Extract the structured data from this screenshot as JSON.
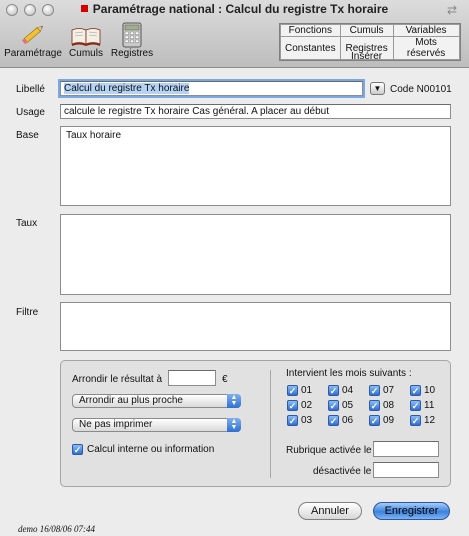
{
  "window": {
    "title": "Paramétrage national : Calcul du registre Tx horaire"
  },
  "toolbar": {
    "items": [
      {
        "label": "Paramétrage",
        "icon": "pencil-icon"
      },
      {
        "label": "Cumuls",
        "icon": "book-icon"
      },
      {
        "label": "Registres",
        "icon": "calculator-icon"
      }
    ]
  },
  "insert": {
    "row1": [
      "Fonctions",
      "Cumuls",
      "Variables"
    ],
    "row2": [
      "Constantes",
      "Registres",
      "Mots réservés"
    ],
    "label": "Insérer"
  },
  "form": {
    "libelle_label": "Libellé",
    "libelle_value": "Calcul du registre Tx horaire",
    "code": "Code N00101",
    "usage_label": "Usage",
    "usage_value": "calcule le registre Tx horaire Cas général. A placer au début",
    "base_label": "Base",
    "base_value": "Taux horaire",
    "taux_label": "Taux",
    "taux_value": "",
    "filtre_label": "Filtre",
    "filtre_value": ""
  },
  "options": {
    "round_label": "Arrondir le résultat à",
    "round_value": "",
    "currency": "€",
    "rounding_select": "Arrondir au plus proche",
    "print_select": "Ne pas imprimer",
    "internal_label": "Calcul interne ou information",
    "internal_checked": true,
    "months_label": "Intervient les mois suivants :",
    "months": [
      "01",
      "02",
      "03",
      "04",
      "05",
      "06",
      "07",
      "08",
      "09",
      "10",
      "11",
      "12"
    ],
    "activated_label": "Rubrique activée le",
    "activated_value": "",
    "deactivated_label": "désactivée le",
    "deactivated_value": ""
  },
  "buttons": {
    "cancel": "Annuler",
    "save": "Enregistrer"
  },
  "footer": "demo 16/08/06 07:44",
  "colors": {
    "accent": "#3d82dd",
    "title_dot": "#d50000"
  }
}
